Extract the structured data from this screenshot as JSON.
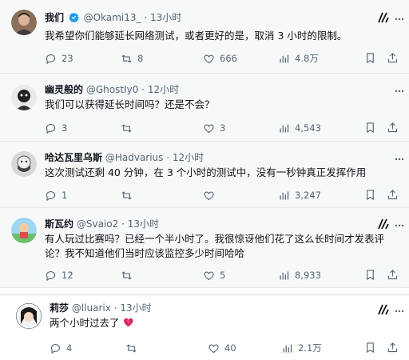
{
  "posts": [
    {
      "name": "我们",
      "handle": "@Okami13_",
      "dot": "·",
      "time": "13小时",
      "text": "我希望你们能够延长网络测试，或者更好的是，取消 3 小时的限制。",
      "replies": "23",
      "reposts": "8",
      "likes": "666",
      "views": "4.8万"
    },
    {
      "name": "幽灵般的",
      "handle": "@GhostIy0",
      "dot": "·",
      "time": "12小时",
      "text": "我们可以获得延长时间吗？还是不会？",
      "replies": "3",
      "reposts": "",
      "likes": "3",
      "views": "4,543"
    },
    {
      "name": "哈达瓦里乌斯",
      "handle": "@Hadvarius",
      "dot": "·",
      "time": "12小时",
      "text": "这次测试还剩 40 分钟，在 3 个小时的测试中，没有一秒钟真正发挥作用",
      "replies": "1",
      "reposts": "",
      "likes": "",
      "views": "3,247"
    },
    {
      "name": "斯瓦约",
      "handle": "@Svaio2",
      "dot": "·",
      "time": "13小时",
      "text_line1": "有人玩过比赛吗？已经一个半小时了。我很惊讶他们花了这么长时间才发表评",
      "text_line2": "论？我不知道他们当时应该监控多少时间哈哈",
      "replies": "12",
      "reposts": "",
      "likes": "5",
      "views": "8,933"
    },
    {
      "name": "莉莎",
      "handle": "@lluarix",
      "dot": "·",
      "time": "13小时",
      "text": "两个小时过去了",
      "replies": "4",
      "reposts": "",
      "likes": "40",
      "views": "2.1万"
    }
  ],
  "colors": {
    "verified": "#1d9bf0",
    "text": "#0f1419",
    "muted": "#536471",
    "broken_heart": "#e0245e"
  }
}
